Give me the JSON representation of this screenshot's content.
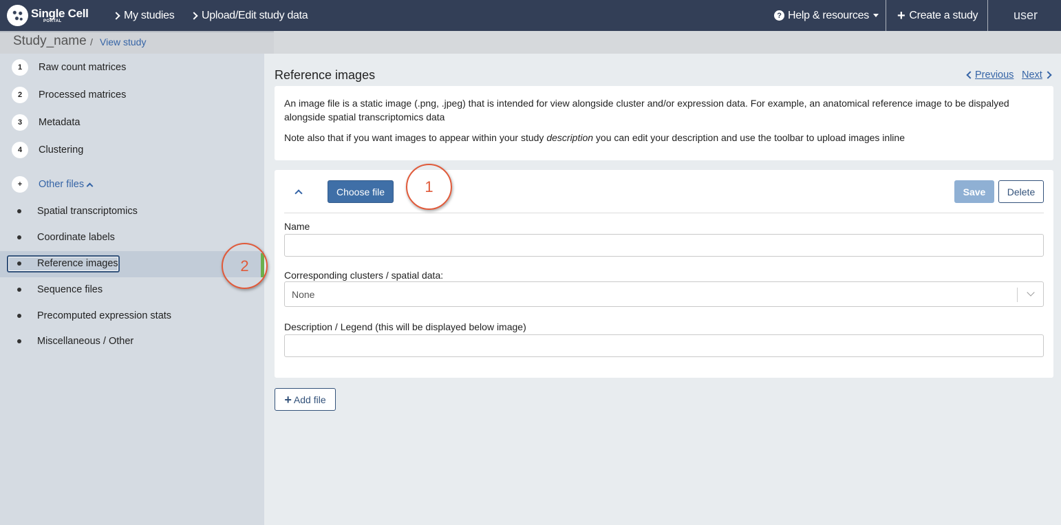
{
  "nav": {
    "logo_title": "Single Cell",
    "logo_sub": "PORTAL",
    "my_studies": "My studies",
    "upload_edit": "Upload/Edit study data",
    "help": "Help & resources",
    "create_study": "Create a study",
    "user": "user"
  },
  "breadcrumb": {
    "study_name": "Study_name",
    "separator": "/",
    "view_study": "View study"
  },
  "sidebar": {
    "steps": [
      {
        "num": "1",
        "label": "Raw count matrices"
      },
      {
        "num": "2",
        "label": "Processed matrices"
      },
      {
        "num": "3",
        "label": "Metadata"
      },
      {
        "num": "4",
        "label": "Clustering"
      }
    ],
    "other": {
      "num": "+",
      "label": "Other files"
    },
    "sub_items": [
      {
        "label": "Spatial transcriptomics"
      },
      {
        "label": "Coordinate labels"
      },
      {
        "label": "Reference images"
      },
      {
        "label": "Sequence files"
      },
      {
        "label": "Precomputed expression stats"
      },
      {
        "label": "Miscellaneous / Other"
      }
    ],
    "selected_item": "Reference images"
  },
  "callouts": [
    "1",
    "2"
  ],
  "main": {
    "title": "Reference images",
    "previous": "Previous",
    "next": "Next",
    "info_p1": "An image file is a static image (.png, .jpeg) that is intended for view alongside cluster and/or expression data. For example, an anatomical reference image to be dispalyed alongside spatial transcriptomics data",
    "info_p2_before": "Note also that if you want images to appear within your study ",
    "info_p2_em": "description",
    "info_p2_after": " you can edit your description and use the toolbar to upload images inline",
    "form": {
      "choose_file": "Choose file",
      "save": "Save",
      "delete": "Delete",
      "name_label": "Name",
      "name_value": "",
      "clusters_label": "Corresponding clusters / spatial data:",
      "clusters_value": "None",
      "description_label": "Description / Legend (this will be displayed below image)",
      "description_value": ""
    },
    "add_file": "Add file"
  },
  "colors": {
    "nav_bg": "#333f57",
    "primary": "#3f6fa7",
    "link": "#3564a6",
    "callout": "#e05a3a",
    "selected_bar": "#6bb04d"
  }
}
